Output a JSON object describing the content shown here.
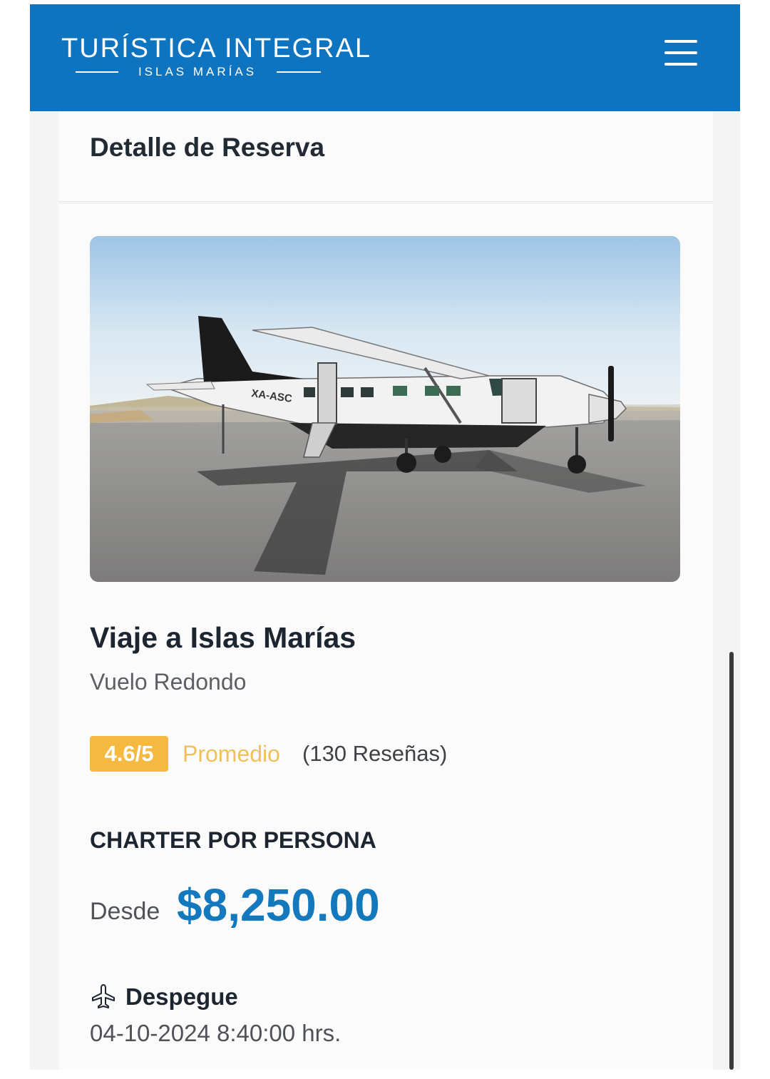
{
  "header": {
    "brand_name": "TURÍSTICA INTEGRAL",
    "brand_subtitle": "ISLAS MARÍAS",
    "menu_icon": "hamburger-menu-icon",
    "background_color": "#0f74bf"
  },
  "section": {
    "title": "Detalle de Reserva"
  },
  "trip": {
    "image_subject": "white single-engine aircraft XA-ASC on runway",
    "aircraft_registration": "XA-ASC",
    "title": "Viaje a Islas Marías",
    "type": "Vuelo Redondo"
  },
  "rating": {
    "score": "4.6/5",
    "label": "Promedio",
    "reviews": "(130 Reseñas)",
    "badge_color": "#f5b942"
  },
  "price": {
    "heading": "CHARTER POR PERSONA",
    "prefix": "Desde",
    "amount": "$8,250.00",
    "color": "#1478bd"
  },
  "departure": {
    "icon": "airplane-icon",
    "label": "Despegue",
    "datetime": "04-10-2024 8:40:00 hrs."
  }
}
